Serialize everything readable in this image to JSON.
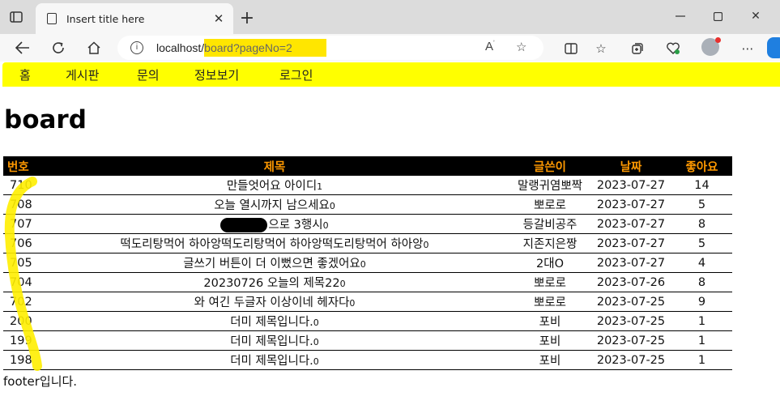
{
  "browser": {
    "tab_title": "Insert title here",
    "url_host": "localhost/",
    "url_path": "board?pageNo=2"
  },
  "nav": {
    "items": [
      "홈",
      "게시판",
      "문의",
      "정보보기",
      "로그인"
    ]
  },
  "page": {
    "title": "board",
    "footer": "footer입니다."
  },
  "table": {
    "headers": [
      "번호",
      "제목",
      "글쓴이",
      "날짜",
      "좋아요"
    ],
    "rows": [
      {
        "num": "710",
        "title": "만들엇어요 아이디",
        "count": "1",
        "author": "말랭귀염뽀짝",
        "date": "2023-07-27",
        "likes": "14"
      },
      {
        "num": "708",
        "title": "오늘 열시까지 남으세요",
        "count": "0",
        "author": "뽀로로",
        "date": "2023-07-27",
        "likes": "5"
      },
      {
        "num": "707",
        "title": "으로 3행시",
        "count": "0",
        "author": "등갈비공주",
        "date": "2023-07-27",
        "likes": "8",
        "masked": true
      },
      {
        "num": "706",
        "title": "떡도리탕먹어 하아앙떡도리탕먹어 하아앙떡도리탕먹어 하아앙",
        "count": "0",
        "author": "지존지은짱",
        "date": "2023-07-27",
        "likes": "5"
      },
      {
        "num": "705",
        "title": "글쓰기 버튼이 더 이뻤으면 좋겠어요",
        "count": "0",
        "author": "2대O",
        "date": "2023-07-27",
        "likes": "4"
      },
      {
        "num": "704",
        "title": "20230726 오늘의 제목22",
        "count": "0",
        "author": "뽀로로",
        "date": "2023-07-26",
        "likes": "8"
      },
      {
        "num": "702",
        "title": "와 여긴 두글자 이상이네 헤자다",
        "count": "0",
        "author": "뽀로로",
        "date": "2023-07-25",
        "likes": "9"
      },
      {
        "num": "200",
        "title": "더미 제목입니다.",
        "count": "0",
        "author": "포비",
        "date": "2023-07-25",
        "likes": "1"
      },
      {
        "num": "199",
        "title": "더미 제목입니다.",
        "count": "0",
        "author": "포비",
        "date": "2023-07-25",
        "likes": "1"
      },
      {
        "num": "198",
        "title": "더미 제목입니다.",
        "count": "0",
        "author": "포비",
        "date": "2023-07-25",
        "likes": "1"
      }
    ]
  },
  "icons": {
    "tab_actions": "tab-actions-icon",
    "back": "back-arrow-icon",
    "refresh": "refresh-icon",
    "home": "home-icon",
    "info": "info-icon",
    "read_aloud": "read-aloud-icon",
    "favorite": "star-icon",
    "split": "split-screen-icon",
    "favorites": "favorites-icon",
    "collections": "collections-icon",
    "health": "browser-essentials-icon",
    "profile": "profile-avatar",
    "more": "more-icon"
  },
  "colors": {
    "nav_bg": "#ffff00",
    "header_bg": "#000000",
    "header_text": "#ff9900",
    "url_highlight": "#ffe600",
    "annotation": "#ffee00"
  }
}
